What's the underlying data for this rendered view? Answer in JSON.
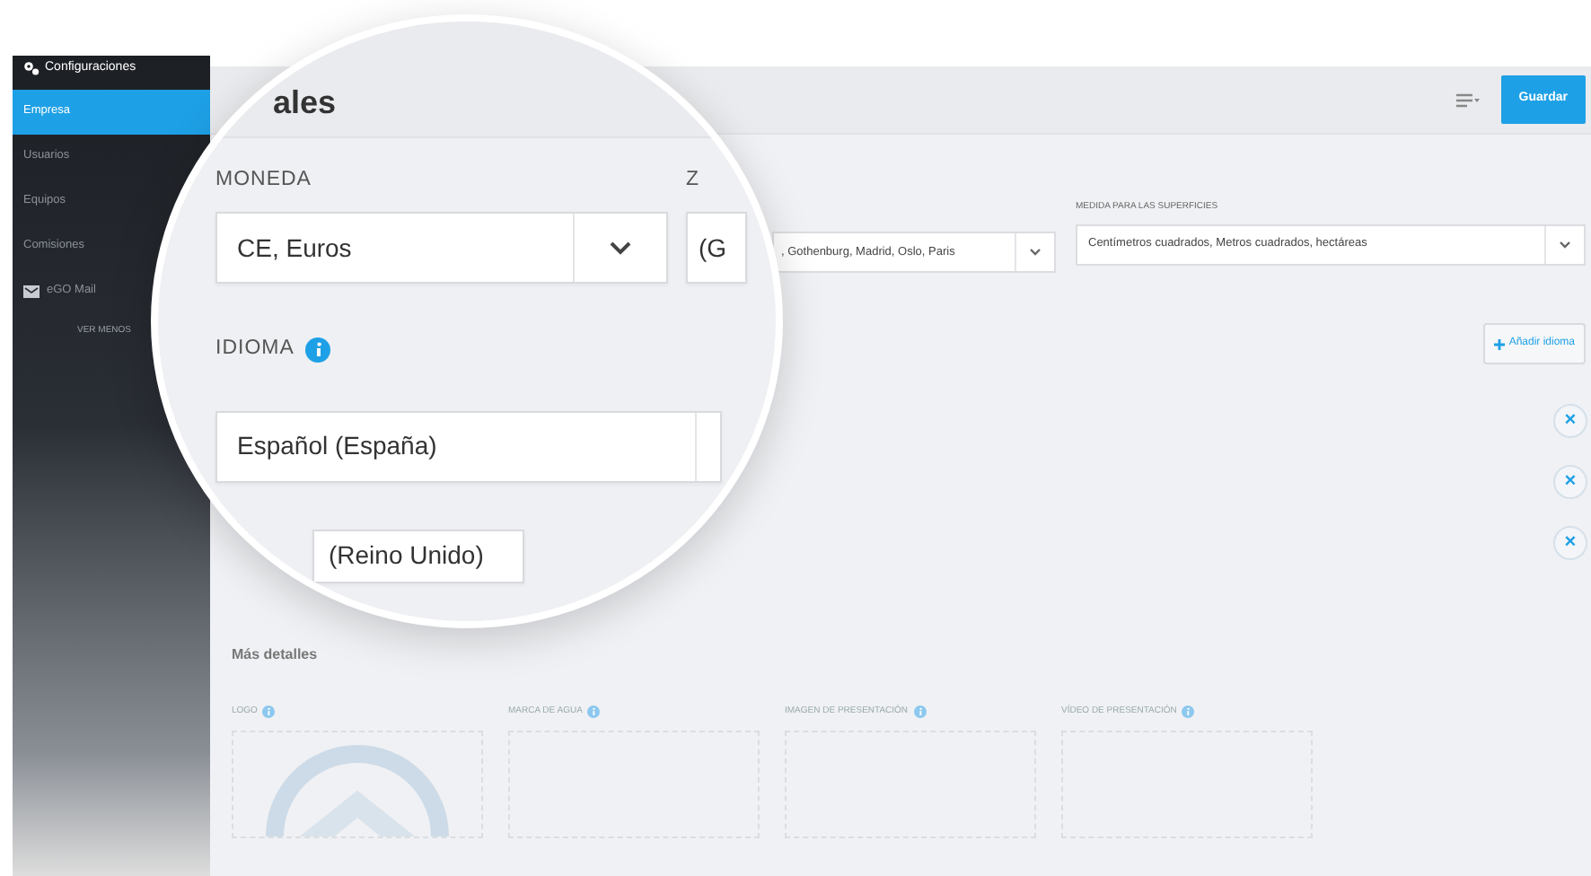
{
  "sidebar": {
    "header": "Configuraciones",
    "items": [
      {
        "label": "Empresa",
        "selected": true,
        "kind": "plain"
      },
      {
        "label": "Usuarios",
        "selected": false,
        "kind": "plain"
      },
      {
        "label": "Equipos",
        "selected": false,
        "kind": "plain"
      },
      {
        "label": "Comisiones",
        "selected": false,
        "kind": "plain"
      },
      {
        "label": "eGO Mail",
        "selected": false,
        "kind": "mail"
      }
    ],
    "toggle": "VER MENOS"
  },
  "header": {
    "save_button": "Guardar"
  },
  "fields": {
    "zone_value": ", Gothenburg, Madrid, Oslo, Paris",
    "area_label": "MEDIDA PARA LAS SUPERFICIES",
    "area_value": "Centímetros cuadrados, Metros cuadrados, hectáreas"
  },
  "add_language_button": "Añadir idioma",
  "remove_buttons": [
    "×",
    "×",
    "×"
  ],
  "more_details": {
    "title": "Más detalles",
    "media": [
      {
        "label": "LOGO",
        "kind": "logo"
      },
      {
        "label": "MARCA DE AGUA",
        "kind": "empty"
      },
      {
        "label": "IMAGEN DE PRESENTACIÓN",
        "kind": "empty"
      },
      {
        "label": "VÍDEO DE PRESENTACIÓN",
        "kind": "empty"
      }
    ]
  },
  "magnifier": {
    "title": "ales",
    "currency_label": "MONEDA",
    "currency_value": "CE, Euros",
    "zone_label": "Z",
    "zone_value": "(G",
    "language_label": "IDIOMA",
    "languages": [
      "Español (España)",
      "(Reino Unido)"
    ]
  }
}
